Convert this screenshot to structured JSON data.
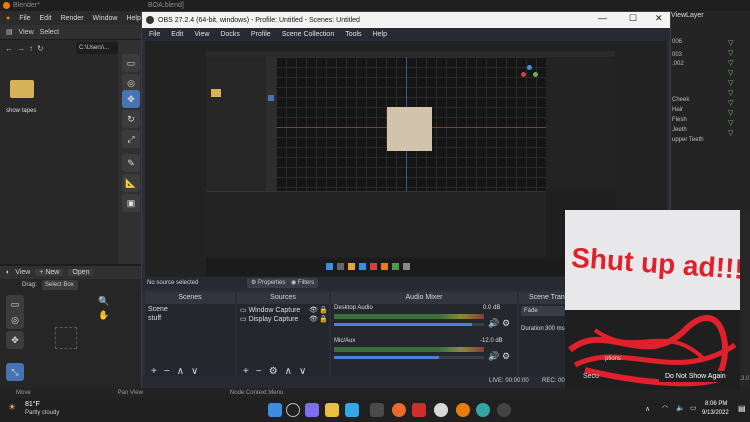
{
  "blender": {
    "title": "Blender*",
    "file_title": "BOA.blend]",
    "menu": [
      "File",
      "Edit",
      "Render",
      "Window",
      "Help"
    ],
    "header_view": "View",
    "header_select": "Select",
    "path": "C:\\Users\\...",
    "folder_label": "show tapes",
    "bottom_view": "View",
    "bottom_new": "New",
    "bottom_open": "Open",
    "drag_label": "Drag:",
    "drag_value": "Select Box",
    "right_header": "ViewLayer",
    "right_items": [
      "006",
      "003",
      ".002",
      "Cheek",
      "Hair",
      "Flesh",
      "Jeeth",
      "upper Teeth"
    ],
    "status_move": "Move",
    "status_pan": "Pan View",
    "status_node": "Node Context Menu",
    "version": "3.3.0"
  },
  "obs": {
    "title": "OBS 27.2.4 (64-bit, windows) - Profile: Untitled - Scenes: Untitled",
    "menu": [
      "File",
      "Edit",
      "View",
      "Docks",
      "Profile",
      "Scene Collection",
      "Tools",
      "Help"
    ],
    "no_source": "No source selected",
    "properties": "Properties",
    "filters": "Filters",
    "scenes_title": "Scenes",
    "scenes": [
      "Scene",
      "stuff"
    ],
    "sources_title": "Sources",
    "sources": [
      "Window Capture",
      "Display Capture"
    ],
    "mixer_title": "Audio Mixer",
    "mixer": [
      {
        "name": "Desktop Audio",
        "db": "0.0 dB",
        "level": 0.92
      },
      {
        "name": "Mic/Aux",
        "db": "-12.0 dB",
        "level": 0.7
      }
    ],
    "transitions_title": "Scene Transiti",
    "transition_value": "Fade",
    "duration_label": "Duration",
    "duration_value": "300 ms",
    "live": "LIVE: 00:00:00",
    "rec": "REC: 00:0"
  },
  "ad": {
    "headline": "Shut up ad!!!!1!!",
    "dismiss": "Do Not Show Again",
    "partial_1": "Secu",
    "partial_2": "ptions"
  },
  "taskbar": {
    "temp": "81°F",
    "weather": "Partly cloudy",
    "time": "8:06 PM",
    "date": "9/13/2022"
  },
  "colors": {
    "blender_accent": "#4772b3",
    "obs_bg": "#2b2e38",
    "ad_red": "#e0202a",
    "blender_green": "#7ec56c"
  }
}
